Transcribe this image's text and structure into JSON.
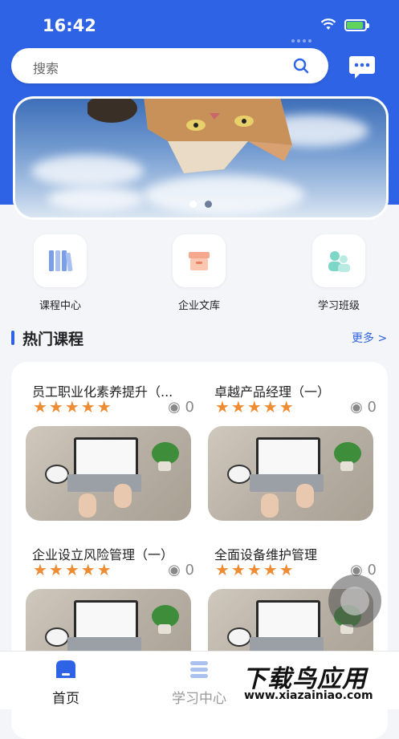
{
  "status_bar": {
    "time": "16:42"
  },
  "search": {
    "placeholder": "搜索"
  },
  "banner": {
    "dots": 2,
    "active_dot": 0
  },
  "nav": [
    {
      "label": "课程中心",
      "icon": "books-icon"
    },
    {
      "label": "企业文库",
      "icon": "archive-box-icon"
    },
    {
      "label": "学习班级",
      "icon": "class-group-icon"
    }
  ],
  "section": {
    "title": "热门课程",
    "more": "更多 >"
  },
  "courses": [
    {
      "title": "员工职业化素养提升（...",
      "rating": 5,
      "views": "0"
    },
    {
      "title": "卓越产品经理（一）",
      "rating": 5,
      "views": "0"
    },
    {
      "title": "企业设立风险管理（一）",
      "rating": 5,
      "views": "0"
    },
    {
      "title": "全面设备维护管理",
      "rating": 5,
      "views": "0"
    }
  ],
  "tabbar": [
    {
      "label": "首页",
      "active": true
    },
    {
      "label": "学习中心",
      "active": false
    }
  ],
  "watermark": {
    "line1": "下载鸟应用",
    "line2": "www.xiazainiao.com"
  },
  "colors": {
    "brand": "#2f63e6",
    "star": "#ed8c33",
    "battery": "#5fd35c"
  }
}
